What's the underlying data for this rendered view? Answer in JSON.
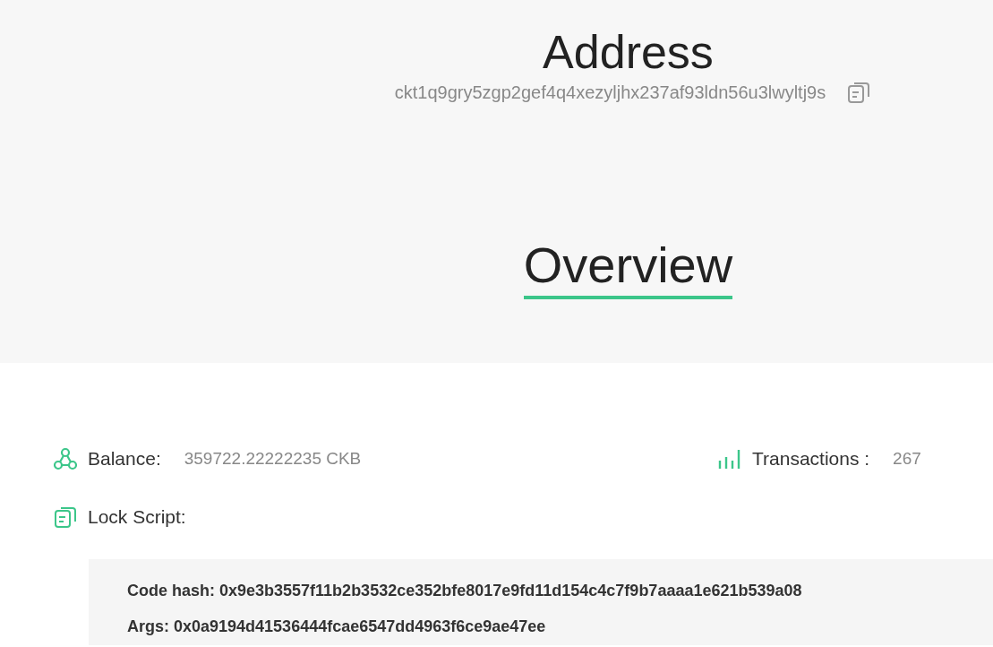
{
  "header": {
    "title": "Address",
    "address": "ckt1q9gry5zgp2gef4q4xezyljhx237af93ldn56u3lwyltj9s"
  },
  "section_title": "Overview",
  "overview": {
    "balance": {
      "label": "Balance:",
      "value": "359722.22222235 CKB"
    },
    "transactions": {
      "label": "Transactions :",
      "value": "267"
    },
    "lock_script": {
      "label": "Lock Script:",
      "lines": [
        "Code hash: 0x9e3b3557f11b2b3532ce352bfe8017e9fd11d154c4c7f9b7aaaa1e621b539a08",
        "Args: 0x0a9194d41536444fcae6547dd4963f6ce9ae47ee"
      ]
    }
  }
}
